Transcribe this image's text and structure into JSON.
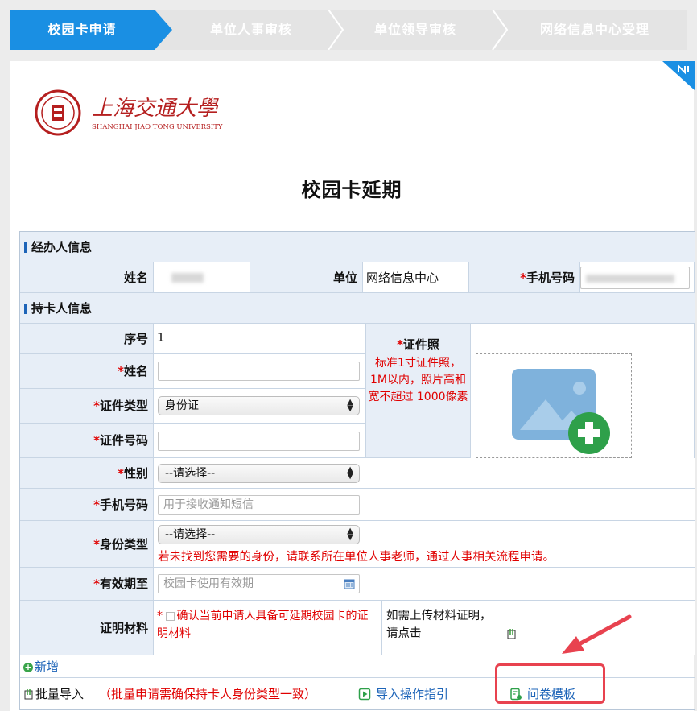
{
  "steps": [
    {
      "label": "校园卡申请",
      "active": true
    },
    {
      "label": "单位人事审核",
      "active": false
    },
    {
      "label": "单位领导审核",
      "active": false
    },
    {
      "label": "网络信息中心受理",
      "active": false
    }
  ],
  "logo": {
    "cn": "上海交通大學",
    "en": "SHANGHAI JIAO TONG UNIVERSITY"
  },
  "page_title": "校园卡延期",
  "handler_section": {
    "title": "经办人信息",
    "name_label": "姓名",
    "unit_label": "单位",
    "unit_value": "网络信息中心",
    "phone_label": "手机号码"
  },
  "holder_section": {
    "title": "持卡人信息",
    "seq_label": "序号",
    "seq_value": "1",
    "name_label": "姓名",
    "idtype_label": "证件类型",
    "idtype_value": "身份证",
    "idno_label": "证件号码",
    "gender_label": "性别",
    "gender_value": "--请选择--",
    "phone_label": "手机号码",
    "phone_placeholder": "用于接收通知短信",
    "identity_label": "身份类型",
    "identity_value": "--请选择--",
    "identity_note": "若未找到您需要的身份，请联系所在单位人事老师，通过人事相关流程申请。",
    "expiry_label": "有效期至",
    "expiry_placeholder": "校园卡使用有效期",
    "proof_label": "证明材料",
    "proof_check_text": "确认当前申请人具备可延期校园卡的证明材料",
    "proof_upload_text1": "如需上传材料证明，",
    "proof_upload_text2": "请点击",
    "photo_label": "证件照",
    "photo_note": "标准1寸证件照，1M以内，照片高和宽不超过 1000像素"
  },
  "add_label": "新增",
  "bulk": {
    "import_label": "批量导入",
    "import_note": "（批量申请需确保持卡人身份类型一致）",
    "guide_label": "导入操作指引",
    "template_label": "问卷模板"
  },
  "colors": {
    "accent": "#1a8fe3",
    "section_bg": "#e7eef7",
    "required": "#e00000",
    "callout": "#e8424f"
  }
}
